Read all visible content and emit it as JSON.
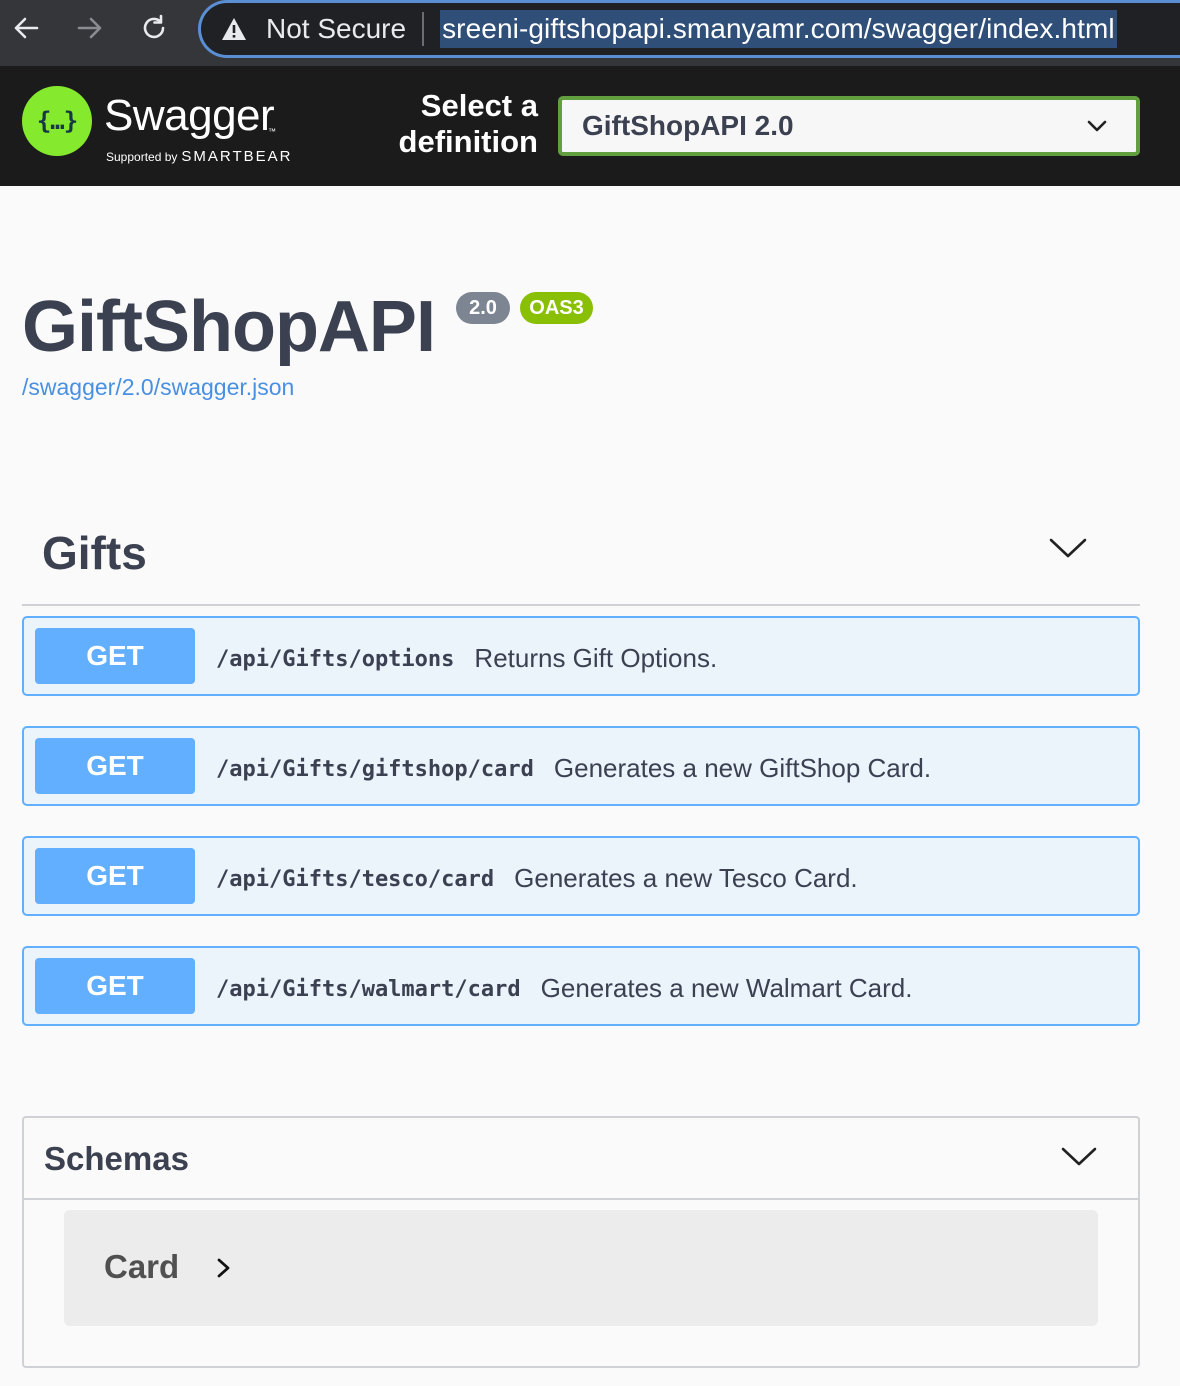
{
  "browser": {
    "security_label": "Not Secure",
    "url": "sreeni-giftshopapi.smanyamr.com/swagger/index.html"
  },
  "topbar": {
    "logo_glyph": "{…}",
    "logo_name": "Swagger",
    "logo_supported": "Supported by",
    "logo_company": "SMARTBEAR",
    "select_label": "Select a definition",
    "select_value": "GiftShopAPI 2.0"
  },
  "info": {
    "title": "GiftShopAPI",
    "version_badge": "2.0",
    "oas_badge": "OAS3",
    "spec_link": "/swagger/2.0/swagger.json"
  },
  "tag": {
    "name": "Gifts",
    "operations": [
      {
        "method": "GET",
        "path": "/api/Gifts/options",
        "summary": "Returns Gift Options."
      },
      {
        "method": "GET",
        "path": "/api/Gifts/giftshop/card",
        "summary": "Generates a new GiftShop Card."
      },
      {
        "method": "GET",
        "path": "/api/Gifts/tesco/card",
        "summary": "Generates a new Tesco Card."
      },
      {
        "method": "GET",
        "path": "/api/Gifts/walmart/card",
        "summary": "Generates a new Walmart Card."
      }
    ]
  },
  "schemas": {
    "title": "Schemas",
    "models": [
      {
        "name": "Card"
      }
    ]
  },
  "colors": {
    "get_method": "#61affe",
    "get_background": "#ebf3fb",
    "logo_green": "#85ea2d",
    "select_border": "#62a03f",
    "oas_badge": "#89bf04",
    "version_badge": "#7d8492",
    "link": "#4990e2"
  },
  "icons": [
    "back-arrow-icon",
    "forward-arrow-icon",
    "reload-icon",
    "warning-icon",
    "chevron-down-icon",
    "chevron-right-icon"
  ]
}
